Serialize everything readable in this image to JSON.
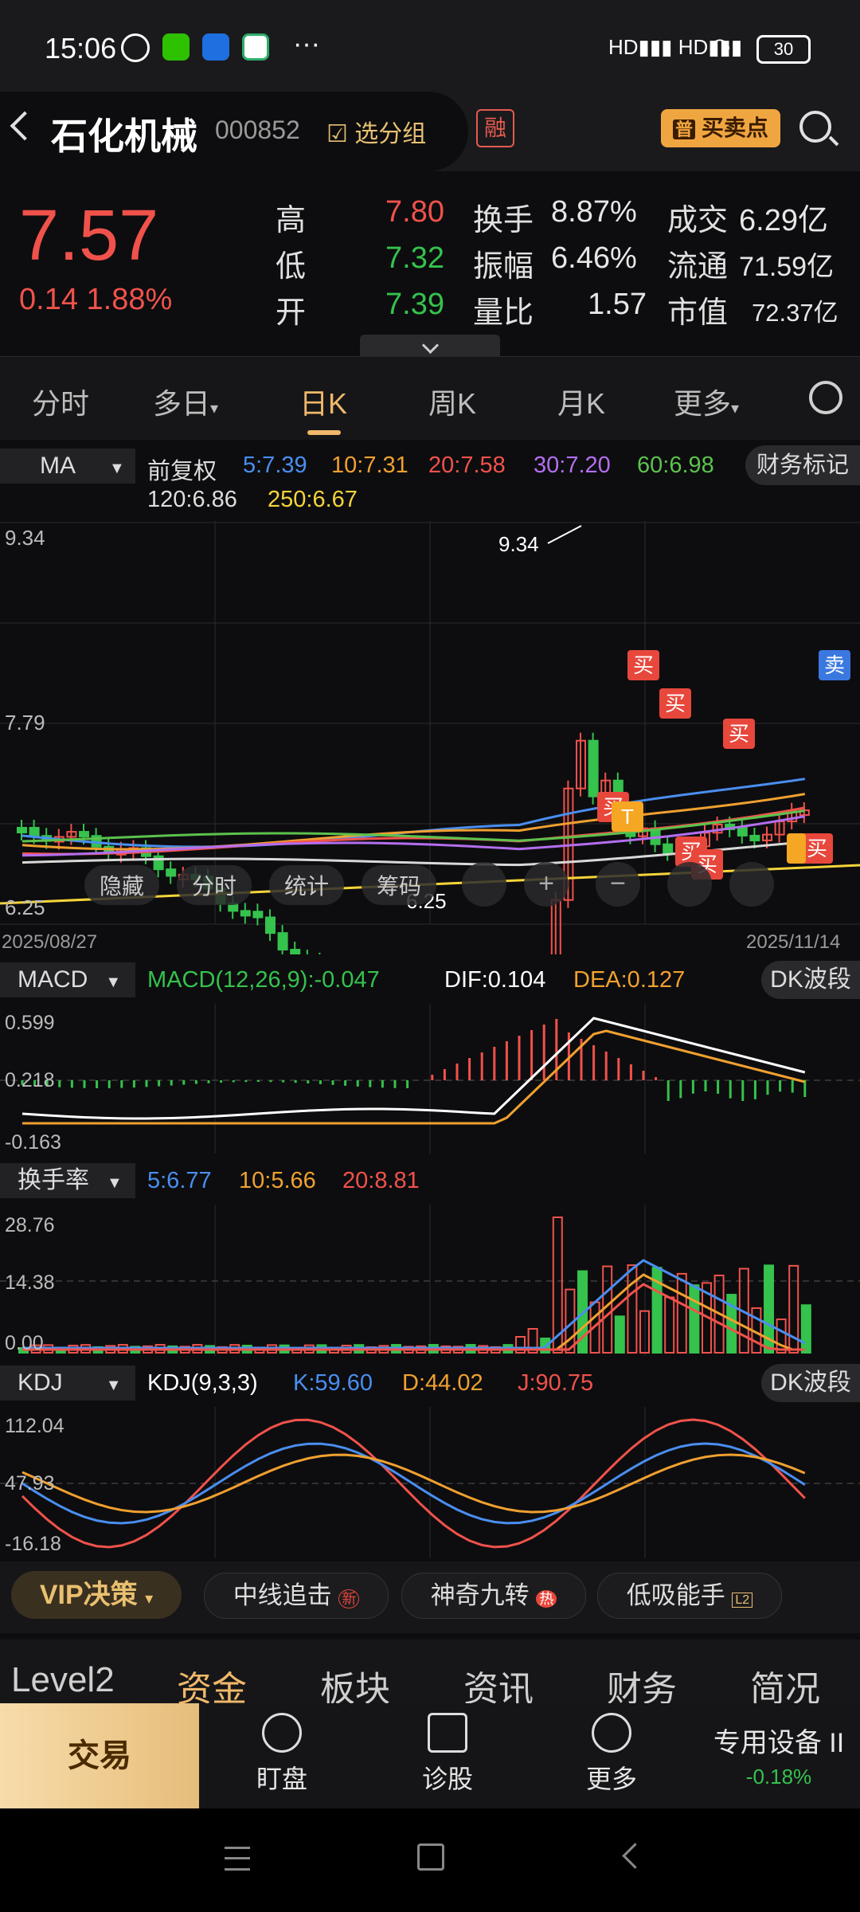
{
  "status": {
    "time": "15:06",
    "battery": "30"
  },
  "header": {
    "name": "石化机械",
    "code": "000852",
    "add_group": "选分组",
    "rong": "融",
    "buy_sell": "买卖点",
    "pu": "普"
  },
  "quote": {
    "price": "7.57",
    "change": "0.14",
    "change_pct": "1.88%",
    "high_label": "高",
    "high": "7.80",
    "low_label": "低",
    "low": "7.32",
    "open_label": "开",
    "open": "7.39",
    "turnover_label": "换手",
    "turnover": "8.87%",
    "amplitude_label": "振幅",
    "amplitude": "6.46%",
    "vol_ratio_label": "量比",
    "vol_ratio": "1.57",
    "amount_label": "成交",
    "amount": "6.29亿",
    "float_label": "流通",
    "float_cap": "71.59亿",
    "mcap_label": "市值",
    "mcap": "72.37亿"
  },
  "tabs": [
    "分时",
    "多日",
    "日K",
    "周K",
    "月K",
    "更多"
  ],
  "ma": {
    "label": "MA",
    "adjust": "前复权",
    "ma5": "5:7.39",
    "ma10": "10:7.31",
    "ma20": "20:7.58",
    "ma30": "30:7.20",
    "ma60": "60:6.98",
    "ma120": "120:6.86",
    "ma250": "250:6.67",
    "finance": "财务标记"
  },
  "colors": {
    "ma5": "#4a8ef0",
    "ma10": "#f0a030",
    "ma20": "#f0524b",
    "ma30": "#b46ef0",
    "ma60": "#5cc24d",
    "ma120": "#d8d8d8",
    "ma250": "#f5d43a",
    "up": "#f0524b",
    "down": "#35c24d"
  },
  "kline": {
    "y_top": "9.34",
    "y_mid": "7.79",
    "y_bottom": "6.25",
    "high_mark": "9.34",
    "low_mark": "6.25",
    "date_start": "2025/08/27",
    "date_end": "2025/11/14",
    "toolbar": [
      "隐藏",
      "分时",
      "统计",
      "筹码"
    ],
    "buy_tag": "买",
    "sell_tag": "卖",
    "t_tag": "T"
  },
  "macd": {
    "label": "MACD",
    "value": "MACD(12,26,9):-0.047",
    "dif": "DIF:0.104",
    "dea": "DEA:0.127",
    "dk": "DK波段",
    "y_top": "0.599",
    "y_mid": "0.218",
    "y_bottom": "-0.163"
  },
  "turnover_panel": {
    "label": "换手率",
    "m5": "5:6.77",
    "m10": "10:5.66",
    "m20": "20:8.81",
    "y_top": "28.76",
    "y_mid": "14.38",
    "y_bottom": "0.00"
  },
  "kdj": {
    "label": "KDJ",
    "params": "KDJ(9,3,3)",
    "k": "K:59.60",
    "d": "D:44.02",
    "j": "J:90.75",
    "dk": "DK波段",
    "y_top": "112.04",
    "y_mid": "47.93",
    "y_bottom": "-16.18"
  },
  "strategy": {
    "vip": "VIP决策",
    "items": [
      "中线追击",
      "神奇九转",
      "低吸能手"
    ],
    "badges": [
      "新",
      "热",
      "L2"
    ]
  },
  "bottom_tabs": [
    "Level2",
    "资金",
    "板块",
    "资讯",
    "财务",
    "简况"
  ],
  "actions": {
    "trade": "交易",
    "watch": "盯盘",
    "diagnose": "诊股",
    "more": "更多",
    "sector": "专用设备 II",
    "sector_chg": "-0.18%"
  }
}
